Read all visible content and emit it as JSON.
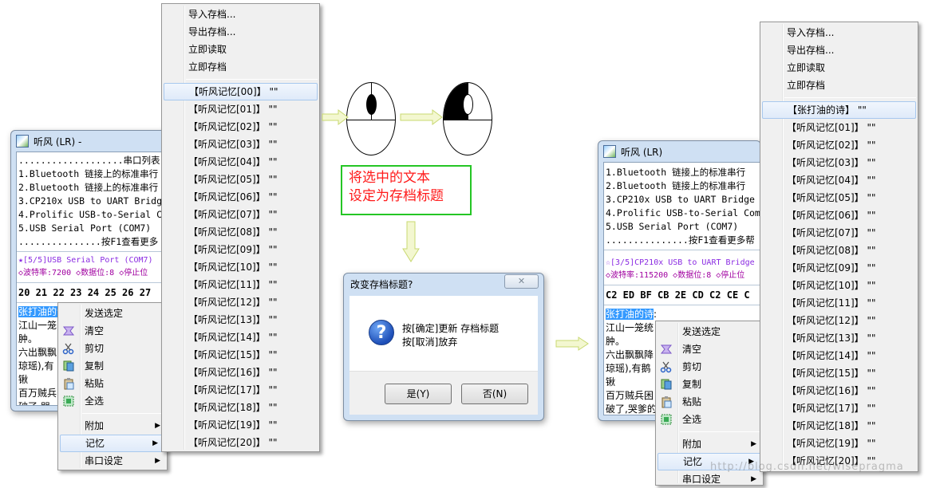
{
  "left_window": {
    "title": "听风 (LR)  -",
    "port_list": [
      "...................串口列表",
      "1.Bluetooth 链接上的标准串行",
      "2.Bluetooth 链接上的标准串行",
      "3.CP210x USB to UART Bridg",
      "4.Prolific USB-to-Serial Co",
      "5.USB Serial Port (COM7)",
      "...............按F1查看更多"
    ],
    "status_port": "★[5/5]USB Serial Port (COM7)",
    "status_params": "◇波特率:7200 ◇数据位:8 ◇停止位",
    "hex_row": "20 21 22 23 24 25 26 27",
    "selected_text": "张打油的诗",
    "text_lines": [
      "江山一笼",
      "肿。",
      "六出飘飘",
      "琼瑶),有",
      "锹",
      "百万贼兵",
      "破了,哭"
    ]
  },
  "right_window": {
    "title": "听风 (LR)",
    "port_list": [
      "1.Bluetooth 链接上的标准串行",
      "2.Bluetooth 链接上的标准串行",
      "3.CP210x USB to UART Bridge",
      "4.Prolific USB-to-Serial Com",
      "5.USB Serial Port (COM7)",
      "...............按F1查看更多帮"
    ],
    "status_port": "☆[3/5]CP210x USB to UART Bridge",
    "status_params": "◇波特率:115200 ◇数据位:8 ◇停止位",
    "hex_row": "C2 ED BF CB 2E CD C2 CE C",
    "selected_text": "张打油的诗",
    "selected_suffix": ":",
    "text_lines": [
      "江山一笼统",
      "肿。",
      "六出飘飘降",
      "琼瑶),有鹅",
      "锹",
      "百万贼兵困",
      "破了,哭爹的"
    ]
  },
  "context_menu_left": {
    "items": [
      {
        "label": "发送选定",
        "icon": ""
      },
      {
        "label": "清空",
        "icon": "clear-icon"
      },
      {
        "label": "剪切",
        "icon": "scissors-icon"
      },
      {
        "label": "复制",
        "icon": "copy-icon"
      },
      {
        "label": "粘贴",
        "icon": "paste-icon"
      },
      {
        "label": "全选",
        "icon": "select-all-icon"
      }
    ],
    "submenus": [
      {
        "label": "附加",
        "arrow": "▶"
      },
      {
        "label": "记忆",
        "arrow": "▶"
      },
      {
        "label": "串口设定",
        "arrow": "▶"
      }
    ]
  },
  "context_menu_right": {
    "items": [
      {
        "label": "发送选定"
      },
      {
        "label": "清空"
      },
      {
        "label": "剪切"
      },
      {
        "label": "复制"
      },
      {
        "label": "粘贴"
      },
      {
        "label": "全选"
      }
    ],
    "submenus": [
      {
        "label": "附加",
        "arrow": "▶"
      },
      {
        "label": "记忆",
        "arrow": "▶"
      },
      {
        "label": "串口设定",
        "arrow": "▶"
      }
    ]
  },
  "memory_menu_left": {
    "actions": [
      "导入存档...",
      "导出存档...",
      "立即读取",
      "立即存档"
    ],
    "slots": [
      "【听风记忆[00]】 \"\"",
      "【听风记忆[01]】 \"\"",
      "【听风记忆[02]】 \"\"",
      "【听风记忆[03]】 \"\"",
      "【听风记忆[04]】 \"\"",
      "【听风记忆[05]】 \"\"",
      "【听风记忆[06]】 \"\"",
      "【听风记忆[07]】 \"\"",
      "【听风记忆[08]】 \"\"",
      "【听风记忆[09]】 \"\"",
      "【听风记忆[10]】 \"\"",
      "【听风记忆[11]】 \"\"",
      "【听风记忆[12]】 \"\"",
      "【听风记忆[13]】 \"\"",
      "【听风记忆[14]】 \"\"",
      "【听风记忆[15]】 \"\"",
      "【听风记忆[16]】 \"\"",
      "【听风记忆[17]】 \"\"",
      "【听风记忆[18]】 \"\"",
      "【听风记忆[19]】 \"\"",
      "【听风记忆[20]】 \"\""
    ]
  },
  "memory_menu_right": {
    "actions": [
      "导入存档...",
      "导出存档...",
      "立即读取",
      "立即存档"
    ],
    "slots": [
      "【张打油的诗】 \"\"",
      "【听风记忆[01]】 \"\"",
      "【听风记忆[02]】 \"\"",
      "【听风记忆[03]】 \"\"",
      "【听风记忆[04]】 \"\"",
      "【听风记忆[05]】 \"\"",
      "【听风记忆[06]】 \"\"",
      "【听风记忆[07]】 \"\"",
      "【听风记忆[08]】 \"\"",
      "【听风记忆[09]】 \"\"",
      "【听风记忆[10]】 \"\"",
      "【听风记忆[11]】 \"\"",
      "【听风记忆[12]】 \"\"",
      "【听风记忆[13]】 \"\"",
      "【听风记忆[14]】 \"\"",
      "【听风记忆[15]】 \"\"",
      "【听风记忆[16]】 \"\"",
      "【听风记忆[17]】 \"\"",
      "【听风记忆[18]】 \"\"",
      "【听风记忆[19]】 \"\"",
      "【听风记忆[20]】 \"\""
    ]
  },
  "callout": {
    "line1": "将选中的文本",
    "line2": "设定为存档标题"
  },
  "dialog": {
    "title": "改变存档标题?",
    "close": "✕",
    "message_line1": "按[确定]更新 存档标题",
    "message_line2": "按[取消]放弃",
    "yes_label": "是(Y)",
    "no_label": "否(N)",
    "icon_glyph": "?"
  },
  "watermark": "http://blog.csdn.net/wisepragma",
  "colors": {
    "arrow": "#e6f0a0",
    "callout_border": "#25c625",
    "callout_text": "#ff1a1a"
  }
}
